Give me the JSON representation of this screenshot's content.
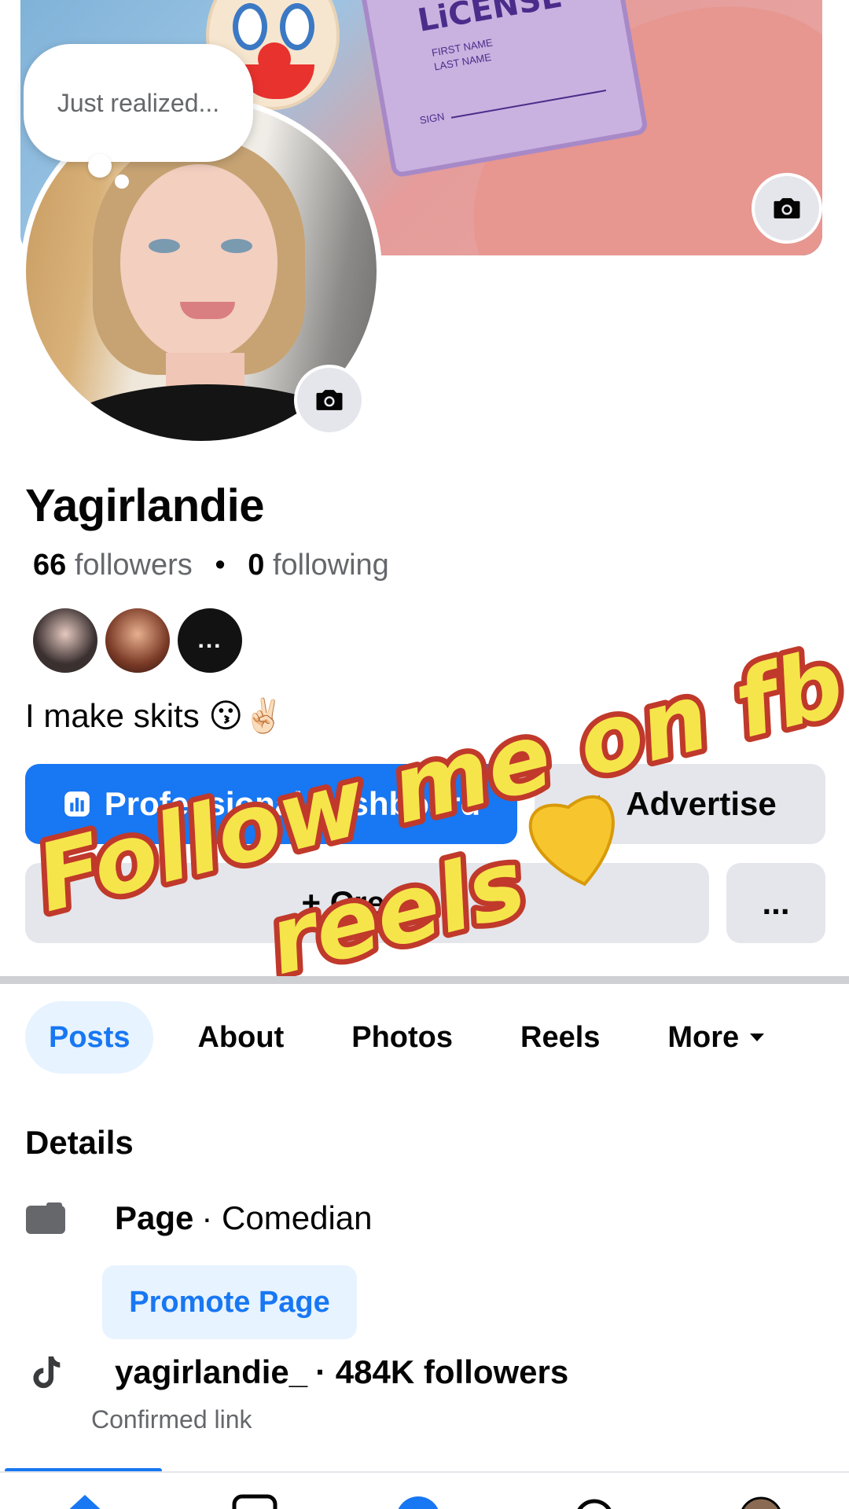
{
  "bubble": {
    "text": "Just realized..."
  },
  "cover": {
    "license_text": "LiCENSE",
    "first_name": "FIRST NAME",
    "last_name": "LAST NAME",
    "sign": "SIGN",
    "camera_icon": "camera-icon"
  },
  "profile": {
    "name": "Yagirlandie",
    "followers_count": "66",
    "followers_label": "followers",
    "separator": "•",
    "following_count": "0",
    "following_label": "following",
    "mutual_more": "...",
    "bio": "I make skits 😗✌🏻"
  },
  "actions": {
    "professional_dashboard": "Professional dashboard",
    "advertise": "Advertise",
    "add_story": "+ Create",
    "more": "..."
  },
  "overlay": {
    "line1": "Follow me on fb",
    "line2": "reels",
    "emoji": "💛",
    "colors": {
      "fill": "#f6e54a",
      "stroke": "#c0392b"
    }
  },
  "tabs": [
    {
      "label": "Posts",
      "active": true
    },
    {
      "label": "About"
    },
    {
      "label": "Photos"
    },
    {
      "label": "Reels"
    },
    {
      "label": "More"
    }
  ],
  "details": {
    "heading": "Details",
    "page_label": "Page",
    "page_category": "· Comedian",
    "promote": "Promote Page",
    "tiktok_handle": "yagirlandie_",
    "tiktok_followers": "· 484K followers",
    "tiktok_sub": "Confirmed link"
  },
  "theme": {
    "accent": "#1877f2",
    "accent_light": "#e7f3ff",
    "gray_button": "#e4e6eb",
    "secondary_text": "#65676b"
  }
}
